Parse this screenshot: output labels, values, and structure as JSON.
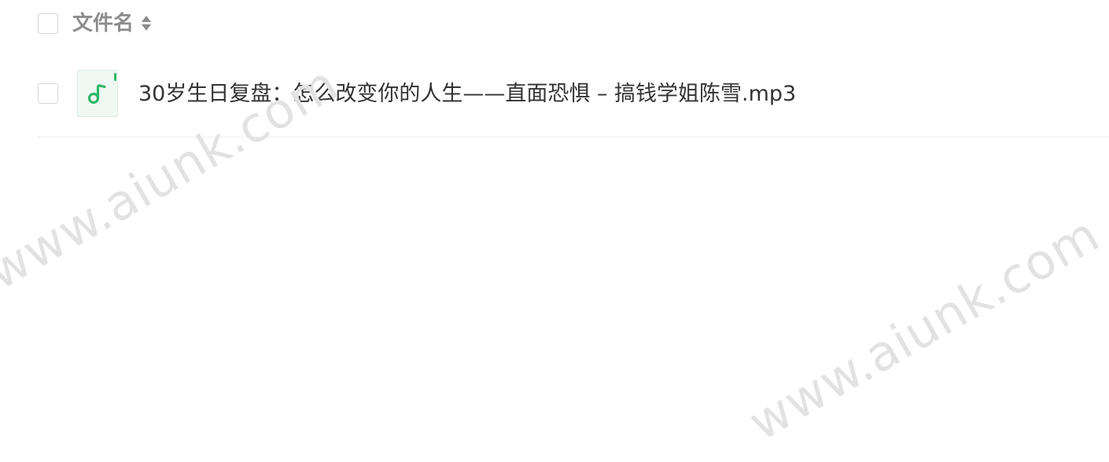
{
  "file_list": {
    "header": {
      "name_label": "文件名"
    },
    "rows": [
      {
        "file_name": "30岁生日复盘：怎么改变你的人生——直面恐惧 – 搞钱学姐陈雪.mp3",
        "type_icon": "music-note-icon"
      }
    ]
  },
  "watermarks": [
    "www.aiunk.com",
    "www.aiunk.com"
  ],
  "colors": {
    "audio_icon_accent": "#2fb767",
    "audio_icon_bg": "#f0f8f3",
    "header_text": "#8c8c8c",
    "body_text": "#333333",
    "divider": "#eeeeee"
  }
}
